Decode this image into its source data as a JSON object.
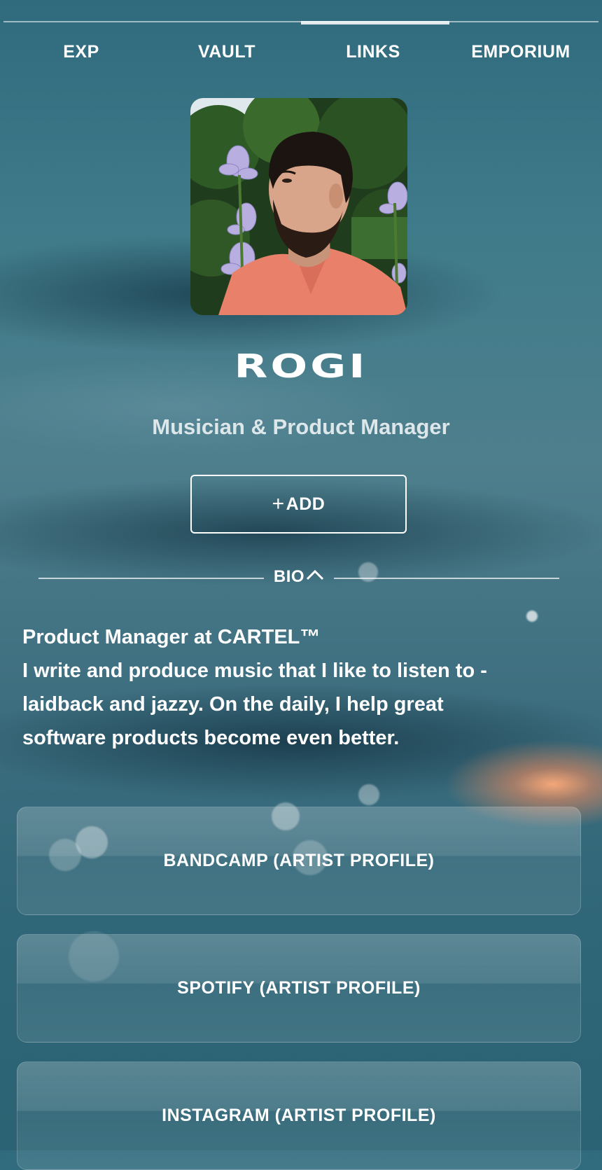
{
  "nav": {
    "items": [
      {
        "label": "EXP"
      },
      {
        "label": "VAULT"
      },
      {
        "label": "LINKS",
        "active": true
      },
      {
        "label": "EMPORIUM"
      }
    ]
  },
  "profile": {
    "name": "ROGI",
    "subtitle": "Musician & Product Manager",
    "add_label": "ADD",
    "add_icon": "plus-icon"
  },
  "bio": {
    "toggle_label": "BIO",
    "toggle_icon": "chevron-up-icon",
    "lines": [
      "Product Manager at CARTEL™",
      "I write and produce music that I like to listen to -",
      "laidback and jazzy. On the daily, I help great",
      "software products become even better."
    ]
  },
  "links": [
    {
      "label": "BANDCAMP (ARTIST PROFILE)"
    },
    {
      "label": "SPOTIFY (ARTIST PROFILE)"
    },
    {
      "label": "INSTAGRAM (ARTIST PROFILE)"
    }
  ],
  "colors": {
    "background": "#3f7b8a",
    "text": "#ffffff",
    "subtitle": "#dde7ea",
    "avatar_shirt": "#e8806a"
  }
}
